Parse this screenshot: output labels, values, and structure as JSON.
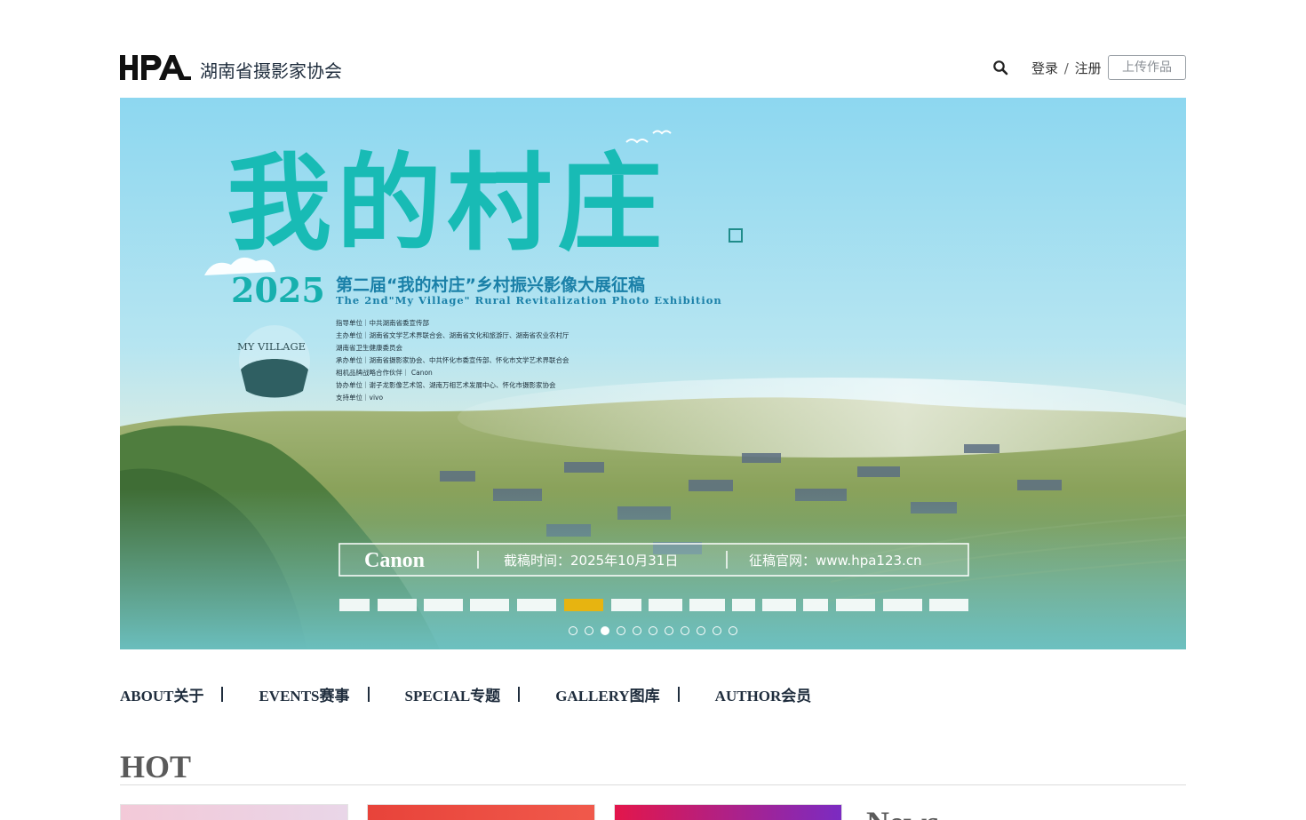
{
  "header": {
    "logo_text": "HPA",
    "site_name": "湖南省摄影家协会",
    "login_label": "登录",
    "auth_separator": "/",
    "register_label": "注册",
    "upload_label": "上传作品"
  },
  "banner": {
    "title_chars": "我的村庄",
    "year": "2025",
    "headline": "第二届“我的村庄”乡村振兴影像大展征稿",
    "subtitle_en": "The 2nd\"My Village\" Rural Revitalization Photo Exhibition",
    "badge_text": "MY VILLAGE",
    "organizers": [
      "指导单位｜中共湖南省委宣传部",
      "主办单位｜湖南省文学艺术界联合会、湖南省文化和旅游厅、湖南省农业农村厅",
      "湖南省卫生健康委员会",
      "承办单位｜湖南省摄影家协会、中共怀化市委宣传部、怀化市文学艺术界联合会",
      "相机品牌战略合作伙伴｜ Canon",
      "协办单位｜谢子龙影像艺术馆、湖南万相艺术发展中心、怀化市摄影家协会",
      "支持单位｜vivo"
    ],
    "sponsor": "Canon",
    "deadline": "截稿时间：2025年10月31日",
    "website": "征稿官网：www.hpa123.cn",
    "dots_total": 11,
    "active_dot": 3
  },
  "nav": {
    "items": [
      "ABOUT关于",
      "EVENTS赛事",
      "SPECIAL专题",
      "GALLERY图库",
      "AUTHOR会员"
    ]
  },
  "sections": {
    "hot_title": "HOT",
    "news_title": "News"
  },
  "colors": {
    "brand": "#1f2d3d",
    "banner_sky": "#8ed6ee",
    "banner_title": "#17b9b4",
    "banner_text": "#1a7fa6"
  }
}
